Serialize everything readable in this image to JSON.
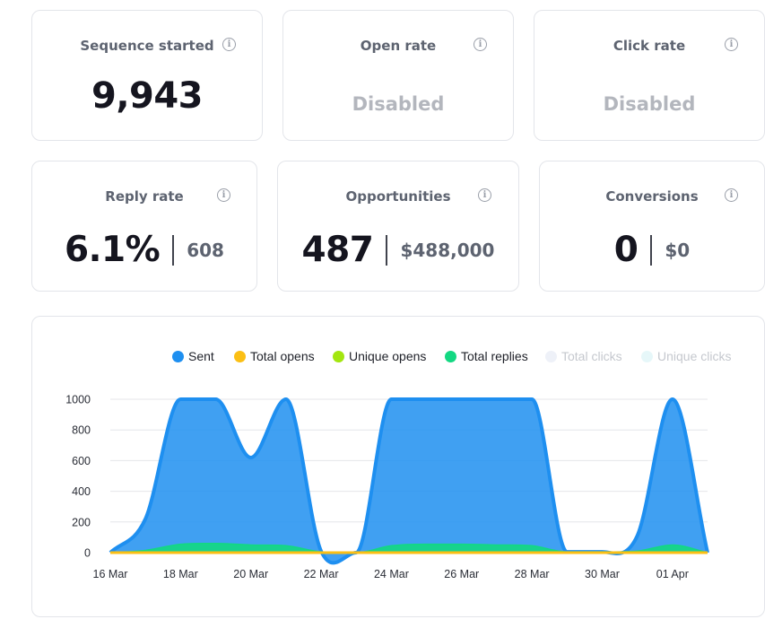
{
  "cards": {
    "sequence_started": {
      "title": "Sequence started",
      "value": "9,943"
    },
    "open_rate": {
      "title": "Open rate",
      "value": "Disabled"
    },
    "click_rate": {
      "title": "Click rate",
      "value": "Disabled"
    },
    "reply_rate": {
      "title": "Reply rate",
      "value": "6.1%",
      "sub": "608"
    },
    "opportunities": {
      "title": "Opportunities",
      "value": "487",
      "sub": "$488,000"
    },
    "conversions": {
      "title": "Conversions",
      "value": "0",
      "sub": "$0"
    }
  },
  "icons": {
    "info": "info-icon"
  },
  "info_glyph": "i",
  "legend": [
    {
      "label": "Sent",
      "color": "#1e8ff0",
      "enabled": true
    },
    {
      "label": "Total opens",
      "color": "#fbbf14",
      "enabled": true
    },
    {
      "label": "Unique opens",
      "color": "#a3e60f",
      "enabled": true
    },
    {
      "label": "Total replies",
      "color": "#13d882",
      "enabled": true
    },
    {
      "label": "Total clicks",
      "color": "#eef1f8",
      "enabled": false
    },
    {
      "label": "Unique clicks",
      "color": "#e6f7f9",
      "enabled": false
    }
  ],
  "chart_data": {
    "type": "area",
    "x": [
      "16 Mar",
      "17 Mar",
      "18 Mar",
      "19 Mar",
      "20 Mar",
      "21 Mar",
      "22 Mar",
      "23 Mar",
      "24 Mar",
      "25 Mar",
      "26 Mar",
      "27 Mar",
      "28 Mar",
      "29 Mar",
      "30 Mar",
      "31 Mar",
      "01 Apr",
      "02 Apr"
    ],
    "x_tick_labels": [
      "16 Mar",
      "18 Mar",
      "20 Mar",
      "22 Mar",
      "24 Mar",
      "26 Mar",
      "28 Mar",
      "30 Mar",
      "01 Apr"
    ],
    "ylim": [
      0,
      1000
    ],
    "y_ticks": [
      0,
      200,
      400,
      600,
      800,
      1000
    ],
    "grid": true,
    "legend_position": "top-right",
    "series": [
      {
        "name": "Sent",
        "color": "#1e8ff0",
        "values": [
          0,
          220,
          1000,
          1000,
          620,
          1000,
          10,
          0,
          1000,
          1000,
          1000,
          1000,
          1000,
          5,
          5,
          110,
          1000,
          0
        ]
      },
      {
        "name": "Total opens",
        "color": "#fbbf14",
        "values": [
          0,
          0,
          0,
          0,
          0,
          0,
          0,
          0,
          0,
          0,
          0,
          0,
          0,
          0,
          0,
          0,
          0,
          0
        ]
      },
      {
        "name": "Unique opens",
        "color": "#a3e60f",
        "values": [
          0,
          0,
          0,
          0,
          0,
          0,
          0,
          0,
          0,
          0,
          0,
          0,
          0,
          0,
          0,
          0,
          0,
          0
        ]
      },
      {
        "name": "Total replies",
        "color": "#13d882",
        "values": [
          0,
          15,
          55,
          60,
          50,
          45,
          5,
          0,
          45,
          55,
          55,
          50,
          45,
          5,
          5,
          10,
          50,
          0
        ]
      }
    ]
  }
}
